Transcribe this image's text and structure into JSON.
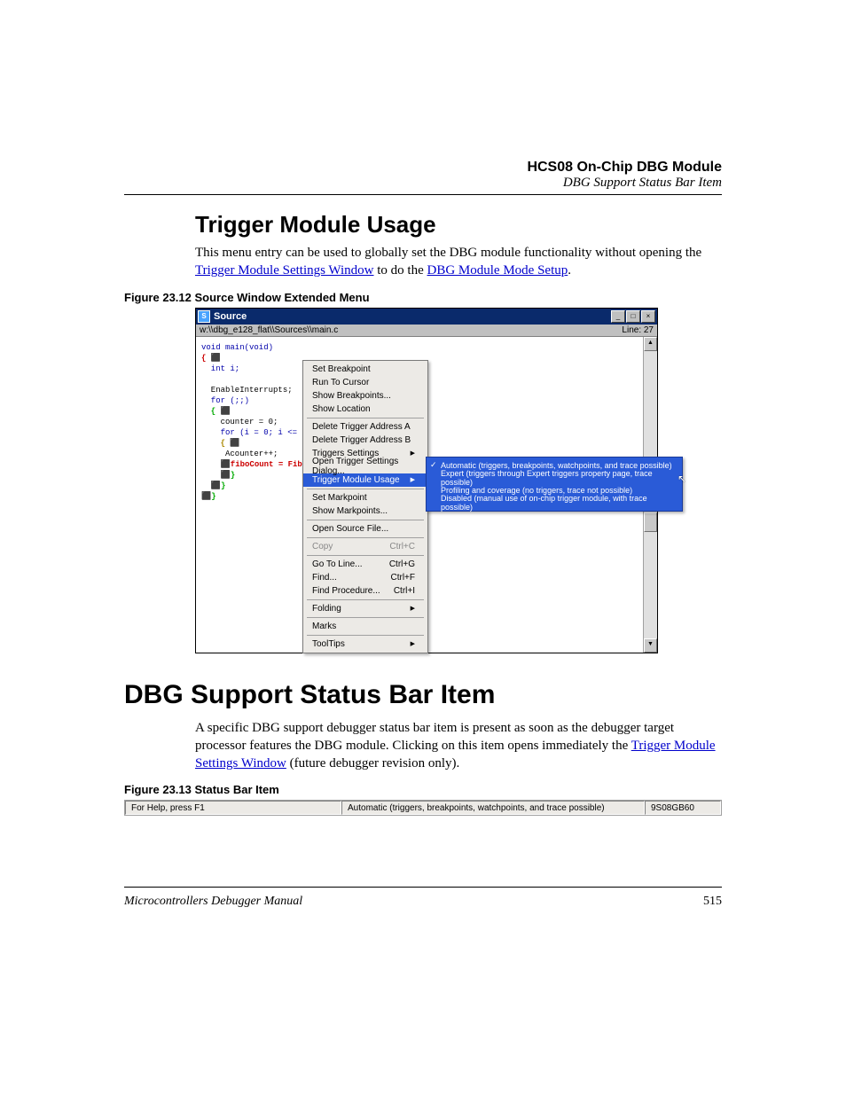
{
  "header": {
    "module": "HCS08 On-Chip DBG Module",
    "section": "DBG Support Status Bar Item"
  },
  "topic1": {
    "title": "Trigger Module Usage",
    "para_a": "This menu entry can be used to globally set the DBG module functionality without opening the ",
    "link1": "Trigger Module Settings Window",
    "para_b": " to do the ",
    "link2": "DBG Module Mode Setup",
    "para_c": "."
  },
  "fig12": {
    "caption": "Figure 23.12  Source Window Extended Menu",
    "title_icon": "S",
    "title": "Source",
    "path": "w:\\\\dbg_e128_flat\\\\Sources\\\\main.c",
    "linelabel": "Line: 27",
    "code": [
      {
        "t": "void main(void)",
        "cls": "kw"
      },
      {
        "t": "{ ⬛",
        "cls": "mark"
      },
      {
        "t": "  int i;",
        "cls": "kw"
      },
      {
        "t": " ",
        "cls": ""
      },
      {
        "t": "  EnableInterrupts;",
        "cls": ""
      },
      {
        "t": "  for (;;)",
        "cls": "kw"
      },
      {
        "t": "  { ⬛",
        "cls": "mark-g"
      },
      {
        "t": "    counter = 0;",
        "cls": ""
      },
      {
        "t": "    for (i = 0; i <= .",
        "cls": "kw"
      },
      {
        "t": "    { ⬛",
        "cls": "mark-y"
      },
      {
        "t": "     Acounter++;",
        "cls": ""
      },
      {
        "t": "    ⬛fiboCount = Fib",
        "cls": "mark"
      },
      {
        "t": "    ⬛}",
        "cls": "mark-g"
      },
      {
        "t": "  ⬛}",
        "cls": "mark-g"
      },
      {
        "t": "⬛}",
        "cls": "mark-g"
      }
    ],
    "menu": [
      {
        "label": "Set Breakpoint"
      },
      {
        "label": "Run To Cursor"
      },
      {
        "label": "Show Breakpoints..."
      },
      {
        "label": "Show Location"
      },
      {
        "sep": true
      },
      {
        "label": "Delete Trigger Address A"
      },
      {
        "label": "Delete Trigger Address B"
      },
      {
        "label": "Triggers Settings",
        "arrow": true
      },
      {
        "label": "Open Trigger Settings Dialog..."
      },
      {
        "label": "Trigger Module Usage",
        "arrow": true,
        "sel": true
      },
      {
        "sep": true
      },
      {
        "label": "Set Markpoint"
      },
      {
        "label": "Show Markpoints..."
      },
      {
        "sep": true
      },
      {
        "label": "Open Source File..."
      },
      {
        "sep": true
      },
      {
        "label": "Copy",
        "shortcut": "Ctrl+C",
        "disabled": true
      },
      {
        "sep": true
      },
      {
        "label": "Go To Line...",
        "shortcut": "Ctrl+G"
      },
      {
        "label": "Find...",
        "shortcut": "Ctrl+F"
      },
      {
        "label": "Find Procedure...",
        "shortcut": "Ctrl+I"
      },
      {
        "sep": true
      },
      {
        "label": "Folding",
        "arrow": true
      },
      {
        "sep": true
      },
      {
        "label": "Marks"
      },
      {
        "sep": true
      },
      {
        "label": "ToolTips",
        "arrow": true
      }
    ],
    "submenu": [
      {
        "label": "Automatic (triggers, breakpoints, watchpoints, and trace possible)",
        "checked": true
      },
      {
        "label": "Expert (triggers through Expert triggers property page, trace possible)"
      },
      {
        "label": "Profiling and coverage (no triggers, trace not possible)"
      },
      {
        "label": "Disabled (manual use of on-chip trigger module, with trace possible)"
      }
    ]
  },
  "topic2": {
    "title": "DBG Support Status Bar Item",
    "para_a": "A specific DBG support debugger status bar item is present as soon as the debugger target processor features the DBG module. Clicking on this item opens immediately the ",
    "link1": "Trigger Module Settings Window",
    "para_b": " (future debugger revision only)."
  },
  "fig13": {
    "caption": "Figure 23.13  Status Bar Item",
    "help": "For Help, press F1",
    "mid": "Automatic (triggers, breakpoints, watchpoints, and trace possible)",
    "right": "9S08GB60"
  },
  "footer": {
    "manual": "Microcontrollers Debugger Manual",
    "page": "515"
  }
}
